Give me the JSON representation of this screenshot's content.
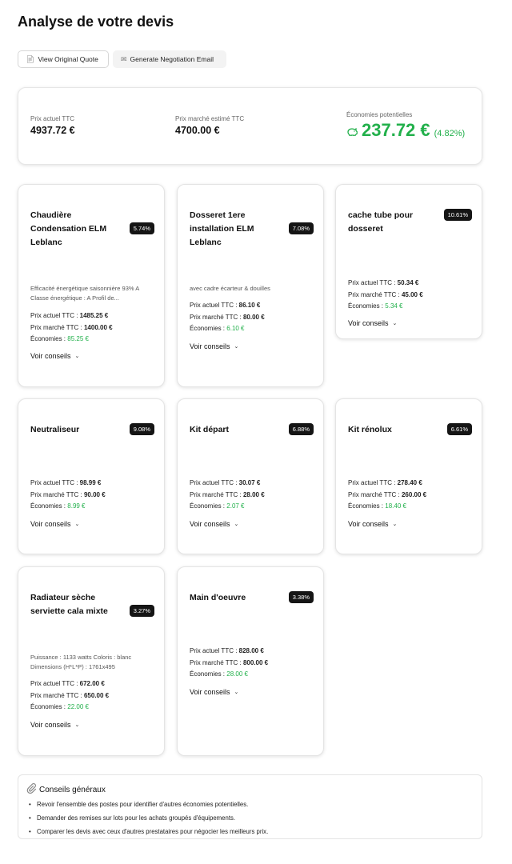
{
  "page": {
    "title": "Analyse de votre devis"
  },
  "actions": {
    "view_quote": {
      "icon": "document-icon",
      "label": "View Original Quote"
    },
    "negotiation": {
      "icon": "envelope-icon",
      "label": "Generate Negotiation Email"
    }
  },
  "summary": {
    "current_label": "Prix actuel TTC",
    "current_value": "4937.72 €",
    "market_label": "Prix marché estimé TTC",
    "market_value": "4700.00 €",
    "savings_label": "Économies potentielles",
    "savings_value": "237.72 €",
    "savings_pct": "(4.82%)",
    "savings_color": "#22b04b"
  },
  "labels": {
    "current": "Prix actuel TTC :",
    "market": "Prix marché TTC :",
    "savings": "Économies :",
    "advice_link": "Voir conseils"
  },
  "items": [
    {
      "title": "Chaudière Condensation ELM Leblanc",
      "badge": "5.74%",
      "description": "Efficacité énergétique saisonnière 93% A Classe énergétique : A Profil de...",
      "current": "1485.25 €",
      "market": "1400.00 €",
      "savings": "85.25 €"
    },
    {
      "title": "Dosseret 1ere installation ELM Leblanc",
      "badge": "7.08%",
      "description": "avec cadre écarteur & douilles",
      "current": "86.10 €",
      "market": "80.00 €",
      "savings": "6.10 €"
    },
    {
      "title": "cache tube pour dosseret",
      "badge": "10.61%",
      "description": "",
      "current": "50.34 €",
      "market": "45.00 €",
      "savings": "5.34 €"
    },
    {
      "title": "Neutraliseur",
      "badge": "9.08%",
      "description": "",
      "current": "98.99 €",
      "market": "90.00 €",
      "savings": "8.99 €"
    },
    {
      "title": "Kit départ",
      "badge": "6.88%",
      "description": "",
      "current": "30.07 €",
      "market": "28.00 €",
      "savings": "2.07 €"
    },
    {
      "title": "Kit rénolux",
      "badge": "6.61%",
      "description": "",
      "current": "278.40 €",
      "market": "260.00 €",
      "savings": "18.40 €"
    },
    {
      "title": "Radiateur sèche serviette cala mixte",
      "badge": "3.27%",
      "description": "Puissance : 1133 watts Coloris : blanc Dimensions (H*L*P) : 1761x495",
      "current": "672.00 €",
      "market": "650.00 €",
      "savings": "22.00 €"
    },
    {
      "title": "Main d'oeuvre",
      "badge": "3.38%",
      "description": "",
      "current": "828.00 €",
      "market": "800.00 €",
      "savings": "28.00 €"
    }
  ],
  "general_advice": {
    "icon": "paperclip-icon",
    "title": "Conseils généraux",
    "items": [
      "Revoir l'ensemble des postes pour identifier d'autres économies potentielles.",
      "Demander des remises sur lots pour les achats groupés d'équipements.",
      "Comparer les devis avec ceux d'autres prestataires pour négocier les meilleurs prix."
    ]
  }
}
